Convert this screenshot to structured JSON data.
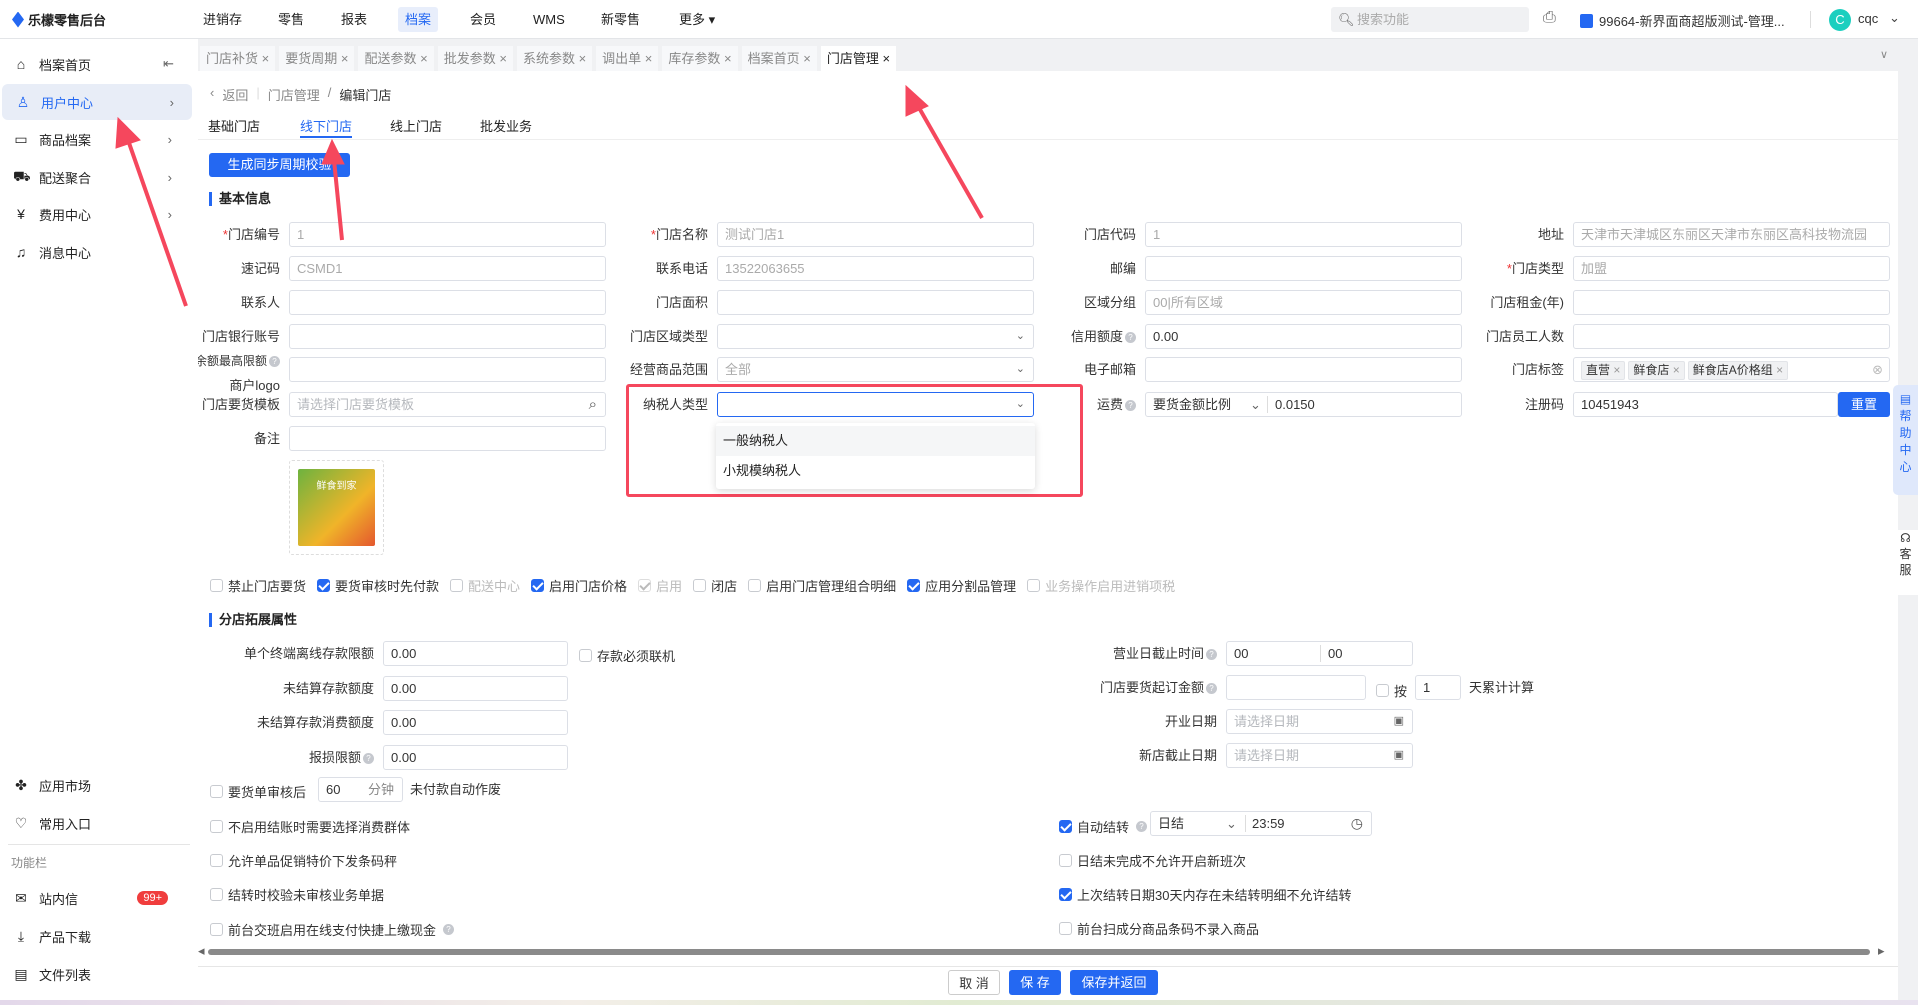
{
  "header": {
    "logo": "乐檬零售后台",
    "nav": [
      "进销存",
      "零售",
      "报表",
      "档案",
      "会员",
      "WMS",
      "新零售",
      "更多"
    ],
    "active_nav": "档案",
    "search_placeholder": "搜索功能",
    "store": "99664-新界面商超版测试-管理...",
    "user": "cqc",
    "avatar_letter": "C"
  },
  "sidebar": {
    "items": [
      {
        "label": "档案首页",
        "icon": "home-icon"
      },
      {
        "label": "用户中心",
        "icon": "user-icon"
      },
      {
        "label": "商品档案",
        "icon": "box-icon"
      },
      {
        "label": "配送聚合",
        "icon": "truck-icon"
      },
      {
        "label": "费用中心",
        "icon": "yen-icon"
      },
      {
        "label": "消息中心",
        "icon": "bell-icon"
      }
    ],
    "bottom": [
      {
        "label": "应用市场",
        "icon": "apps-icon"
      },
      {
        "label": "常用入口",
        "icon": "heart-icon"
      }
    ],
    "section": "功能栏",
    "tools": [
      {
        "label": "站内信",
        "icon": "mail-icon",
        "badge": "99+"
      },
      {
        "label": "产品下载",
        "icon": "download-icon"
      },
      {
        "label": "文件列表",
        "icon": "file-list-icon"
      }
    ]
  },
  "tabs": [
    "门店补货",
    "要货周期",
    "配送参数",
    "批发参数",
    "系统参数",
    "调出单",
    "库存参数",
    "档案首页",
    "门店管理"
  ],
  "breadcrumb": {
    "back": "返回",
    "parent": "门店管理",
    "current": "编辑门店"
  },
  "subtabs": [
    "基础门店",
    "线下门店",
    "线上门店",
    "批发业务"
  ],
  "sync_button": "生成同步周期校验",
  "basic": {
    "title": "基本信息",
    "fields": [
      {
        "label": "门店编号",
        "required": true,
        "value": "1",
        "disabled": true
      },
      {
        "label": "门店名称",
        "required": true,
        "value": "测试门店1",
        "disabled": true
      },
      {
        "label": "门店代码",
        "value": "1",
        "disabled": true
      },
      {
        "label": "地址",
        "value": "天津市天津城区东丽区天津市东丽区高科技物流园",
        "disabled": true
      },
      {
        "label": "速记码",
        "value": "CSMD1",
        "disabled": true
      },
      {
        "label": "联系电话",
        "value": "13522063655",
        "disabled": true
      },
      {
        "label": "邮编",
        "value": ""
      },
      {
        "label": "门店类型",
        "required": true,
        "value": "加盟",
        "disabled": true
      },
      {
        "label": "联系人",
        "value": ""
      },
      {
        "label": "门店面积",
        "value": ""
      },
      {
        "label": "区域分组",
        "value": "00|所有区域",
        "disabled": true
      },
      {
        "label": "门店租金(年)",
        "value": ""
      },
      {
        "label": "门店银行账号",
        "value": ""
      },
      {
        "label": "门店区域类型",
        "value": "",
        "type": "select"
      },
      {
        "label": "信用额度",
        "help": true,
        "value": "0.00"
      },
      {
        "label": "门店员工人数",
        "value": ""
      },
      {
        "label": "卡内余额最高限额",
        "help": true,
        "value": ""
      },
      {
        "label": "经营商品范围",
        "value": "全部",
        "type": "select",
        "disabled": true
      },
      {
        "label": "电子邮箱",
        "value": ""
      },
      {
        "label": "门店标签",
        "type": "tags",
        "tags": [
          "直营",
          "鲜食店",
          "鲜食店A价格组"
        ]
      },
      {
        "label": "门店要货模板",
        "placeholder": "请选择门店要货模板",
        "type": "search"
      },
      {
        "label": "纳税人类型",
        "value": "",
        "type": "select",
        "focused": true
      },
      {
        "label": "运费",
        "help": true,
        "type": "freight",
        "mode": "要货金额比例",
        "value": "0.0150"
      },
      {
        "label": "注册码",
        "value": "10451943",
        "type": "button",
        "button": "重置"
      },
      {
        "label": "备注",
        "value": ""
      }
    ],
    "logo_label": "商户logo",
    "logo_text": "鲜食到家"
  },
  "tax_dropdown": {
    "options": [
      "一般纳税人",
      "小规模纳税人"
    ]
  },
  "flags": [
    {
      "label": "禁止门店要货",
      "checked": false
    },
    {
      "label": "要货审核时先付款",
      "checked": true
    },
    {
      "label": "配送中心",
      "checked": false,
      "disabled": true
    },
    {
      "label": "启用门店价格",
      "checked": true
    },
    {
      "label": "启用",
      "checked": true,
      "disabled": true
    },
    {
      "label": "闭店",
      "checked": false
    },
    {
      "label": "启用门店管理组合明细",
      "checked": false
    },
    {
      "label": "应用分割品管理",
      "checked": true
    },
    {
      "label": "业务操作启用进销项税",
      "checked": false,
      "disabled": true
    }
  ],
  "ext": {
    "title": "分店拓展属性",
    "left": [
      {
        "label": "单个终端离线存款限额",
        "value": "0.00"
      },
      {
        "label": "未结算存款额度",
        "value": "0.00"
      },
      {
        "label": "未结算存款消费额度",
        "value": "0.00"
      },
      {
        "label": "报损限额",
        "value": "0.00",
        "help": true
      }
    ],
    "deposit_online": {
      "label": "存款必须联机",
      "checked": false
    },
    "business_cutoff": {
      "label": "营业日截止时间",
      "h": "00",
      "m": "00"
    },
    "min_order": {
      "label": "门店要货起订金额",
      "value": "",
      "by_label": "按",
      "days": "1",
      "suffix": "天累计计算"
    },
    "open_date": {
      "label": "开业日期",
      "placeholder": "请选择日期"
    },
    "new_store_date": {
      "label": "新店截止日期",
      "placeholder": "请选择日期"
    },
    "auto_void": {
      "label": "要货单审核后",
      "value": "60",
      "unit": "分钟",
      "suffix": "未付款自动作废",
      "checked": false
    },
    "left_checks": [
      {
        "label": "不启用结账时需要选择消费群体",
        "checked": false
      },
      {
        "label": "允许单品促销特价下发条码秤",
        "checked": false
      },
      {
        "label": "结转时校验未审核业务单据",
        "checked": false
      },
      {
        "label": "前台交班启用在线支付快捷上缴现金",
        "checked": false,
        "help": true
      }
    ],
    "auto_settle": {
      "label": "自动结转",
      "checked": true,
      "mode": "日结",
      "time": "23:59"
    },
    "right_checks": [
      {
        "label": "日结未完成不允许开启新班次",
        "checked": false
      },
      {
        "label": "上次结转日期30天内存在未结转明细不允许结转",
        "checked": true
      },
      {
        "label": "前台扫成分商品条码不录入商品",
        "checked": false
      }
    ]
  },
  "footer": {
    "cancel": "取 消",
    "save": "保 存",
    "save_return": "保存并返回"
  },
  "float": {
    "help": "帮助中心",
    "service": "客服"
  },
  "colors": {
    "primary": "#2468f2",
    "annotation": "#f5475d"
  }
}
